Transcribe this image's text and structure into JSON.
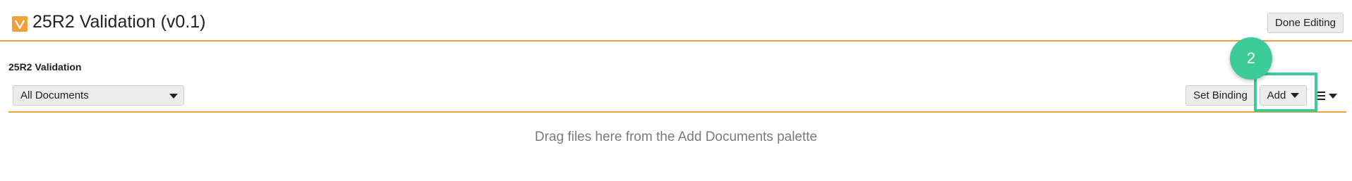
{
  "header": {
    "logo_letter": "V",
    "title": "25R2 Validation (v0.1)",
    "done_button": "Done Editing"
  },
  "section": {
    "title": "25R2 Validation"
  },
  "toolbar": {
    "filter_selected": "All Documents",
    "set_binding_label": "Set Binding",
    "add_label": "Add",
    "menu_icon": "hamburger-list-icon"
  },
  "content": {
    "drop_message": "Drag files here from the Add Documents palette"
  },
  "overlay": {
    "step_number": "2",
    "highlight_color": "#3ecb9a"
  },
  "colors": {
    "accent": "#f0a03c",
    "highlight": "#3ecb9a"
  }
}
